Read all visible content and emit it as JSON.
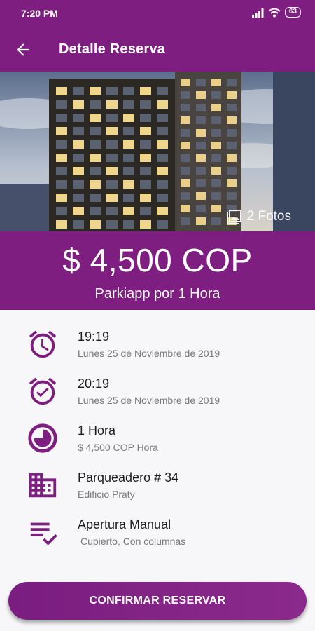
{
  "status_bar": {
    "time": "7:20 PM",
    "battery": "63"
  },
  "app_bar": {
    "title": "Detalle Reserva",
    "back_icon": "arrow-left-icon"
  },
  "hero": {
    "photos_label": "2 Fotos"
  },
  "summary": {
    "price": "$ 4,500 COP",
    "subtitle": "Parkiapp por 1 Hora"
  },
  "details": [
    {
      "icon": "alarm-clock-icon",
      "primary": "19:19",
      "secondary": "Lunes 25 de Noviembre de 2019"
    },
    {
      "icon": "alarm-check-icon",
      "primary": "20:19",
      "secondary": "Lunes 25 de Noviembre de 2019"
    },
    {
      "icon": "clock-pie-icon",
      "primary": "1 Hora",
      "secondary": "$ 4,500 COP Hora"
    },
    {
      "icon": "building-icon",
      "primary": "Parqueadero # 34",
      "secondary": "Edificio Praty"
    },
    {
      "icon": "checklist-icon",
      "primary": "Apertura Manual",
      "secondary": "Cubierto, Con columnas"
    }
  ],
  "confirm_button": {
    "label": "CONFIRMAR RESERVAR"
  },
  "colors": {
    "primary": "#7e1e80",
    "text": "#1e1e1e",
    "muted": "#7a7a7a"
  }
}
